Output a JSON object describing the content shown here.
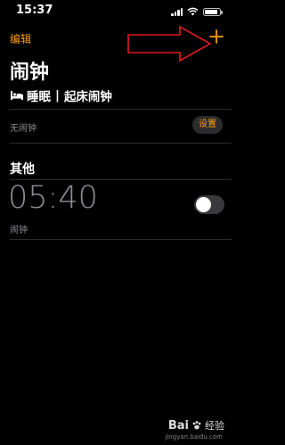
{
  "status_bar": {
    "time": "15:37",
    "battery_fraction": 0.88
  },
  "header": {
    "edit_label": "编辑",
    "add_label": "+"
  },
  "page": {
    "title": "闹钟"
  },
  "sleep": {
    "icon": "bed-icon",
    "title": "睡眠",
    "separator": "|",
    "subtitle": "起床闹钟",
    "no_alarm_text": "无闹钟",
    "setup_label": "设置"
  },
  "others": {
    "section_title": "其他",
    "alarms": [
      {
        "time": "05:40",
        "label": "闹钟",
        "enabled": false
      }
    ]
  },
  "watermark": {
    "logo_text": "Bai",
    "brand": "经验",
    "url": "jingyan.baidu.com"
  },
  "colors": {
    "accent": "#ff9f0a",
    "background": "#000000",
    "secondary_text": "#8e8e93",
    "annotation": "#e0191f"
  }
}
